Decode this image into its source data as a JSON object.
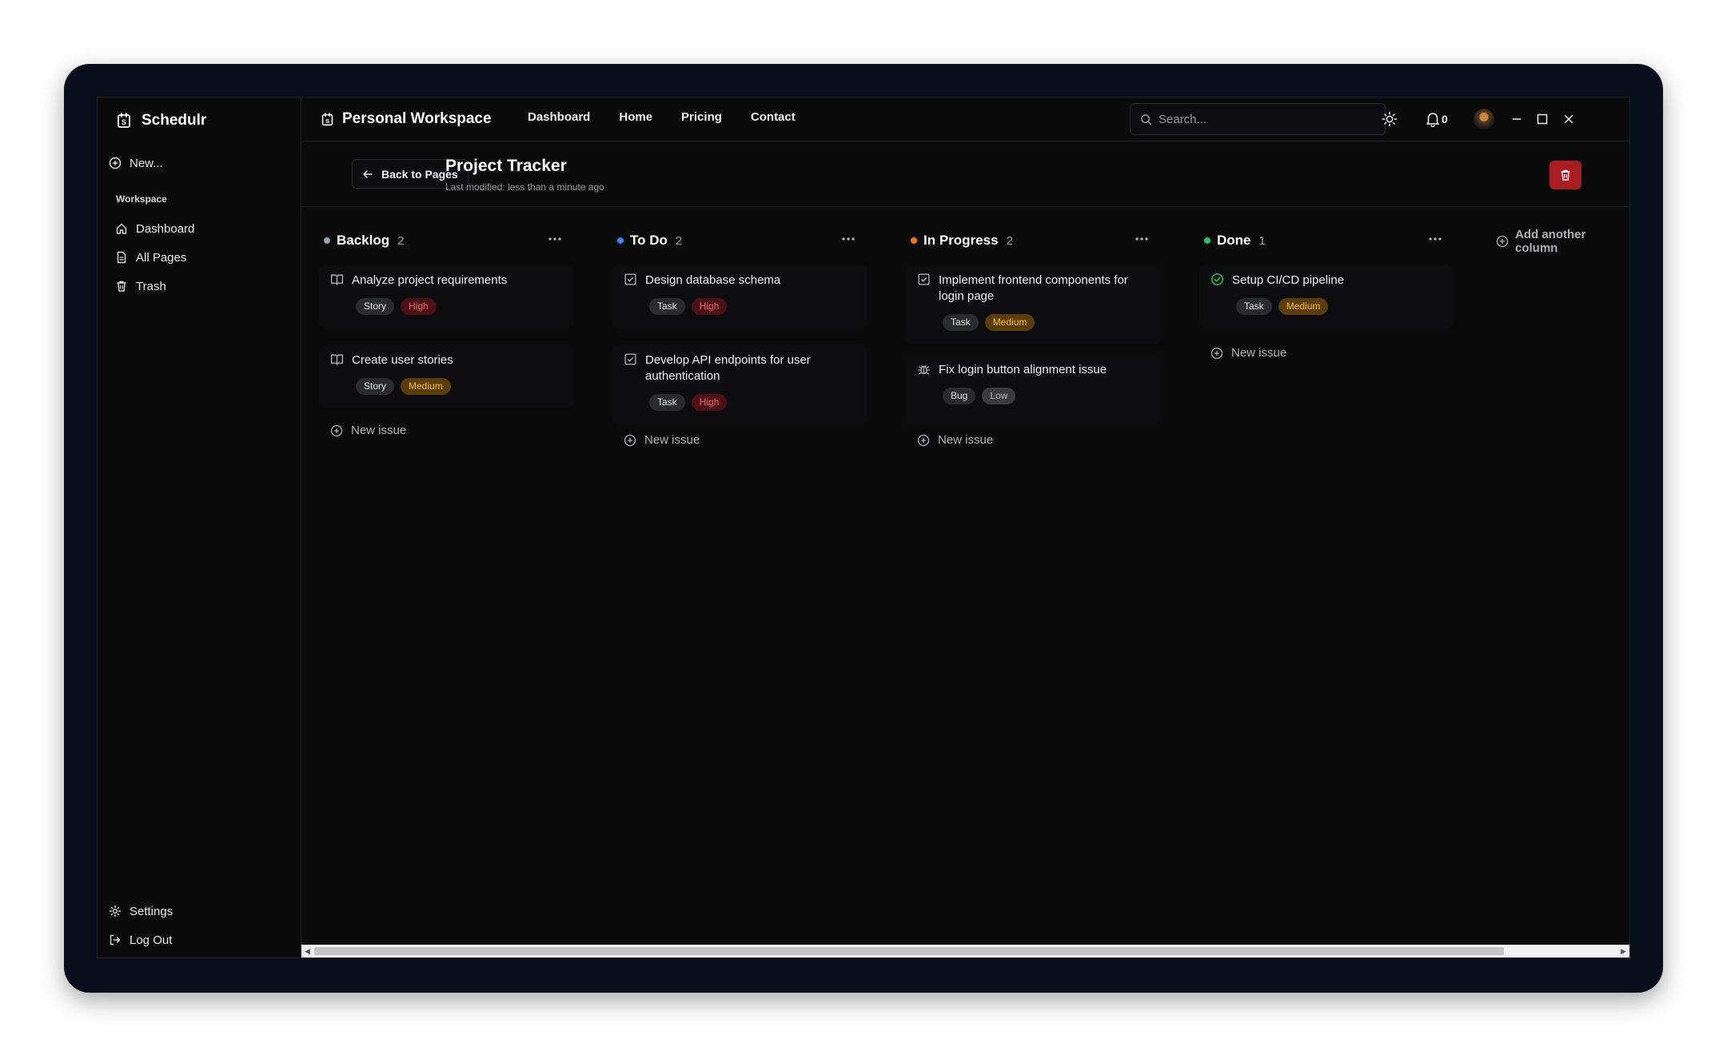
{
  "app": {
    "name": "Schedulr"
  },
  "sidebar": {
    "new_label": "New...",
    "section_label": "Workspace",
    "items": [
      {
        "label": "Dashboard",
        "icon": "home-icon"
      },
      {
        "label": "All Pages",
        "icon": "file-icon"
      },
      {
        "label": "Trash",
        "icon": "trash-icon"
      }
    ],
    "bottom": [
      {
        "label": "Settings",
        "icon": "gear-icon"
      },
      {
        "label": "Log Out",
        "icon": "logout-icon"
      }
    ]
  },
  "topbar": {
    "workspace_title": "Personal Workspace",
    "nav": [
      "Dashboard",
      "Home",
      "Pricing",
      "Contact"
    ],
    "search_placeholder": "Search...",
    "notification_count": "0"
  },
  "page": {
    "back_label": "Back to Pages",
    "title": "Project Tracker",
    "subtitle": "Last modified: less than a minute ago"
  },
  "board": {
    "new_issue_label": "New issue",
    "add_column_label": "Add another column",
    "columns": [
      {
        "title": "Backlog",
        "count": "2",
        "color": "#9ca3af",
        "cards": [
          {
            "title": "Analyze project requirements",
            "icon": "book-icon",
            "type": "Story",
            "priority": "High"
          },
          {
            "title": "Create user stories",
            "icon": "book-icon",
            "type": "Story",
            "priority": "Medium"
          }
        ]
      },
      {
        "title": "To Do",
        "count": "2",
        "color": "#3b82f6",
        "cards": [
          {
            "title": "Design database schema",
            "icon": "checkbox-icon",
            "type": "Task",
            "priority": "High"
          },
          {
            "title": "Develop API endpoints for user authentication",
            "icon": "checkbox-icon",
            "type": "Task",
            "priority": "High"
          }
        ]
      },
      {
        "title": "In Progress",
        "count": "2",
        "color": "#f97316",
        "cards": [
          {
            "title": "Implement frontend components for login page",
            "icon": "checkbox-icon",
            "type": "Task",
            "priority": "Medium"
          },
          {
            "title": "Fix login button alignment issue",
            "icon": "bug-icon",
            "type": "Bug",
            "priority": "Low"
          }
        ]
      },
      {
        "title": "Done",
        "count": "1",
        "color": "#22c55e",
        "cards": [
          {
            "title": "Setup CI/CD pipeline",
            "icon": "check-circle-icon",
            "type": "Task",
            "priority": "Medium"
          }
        ]
      }
    ]
  }
}
